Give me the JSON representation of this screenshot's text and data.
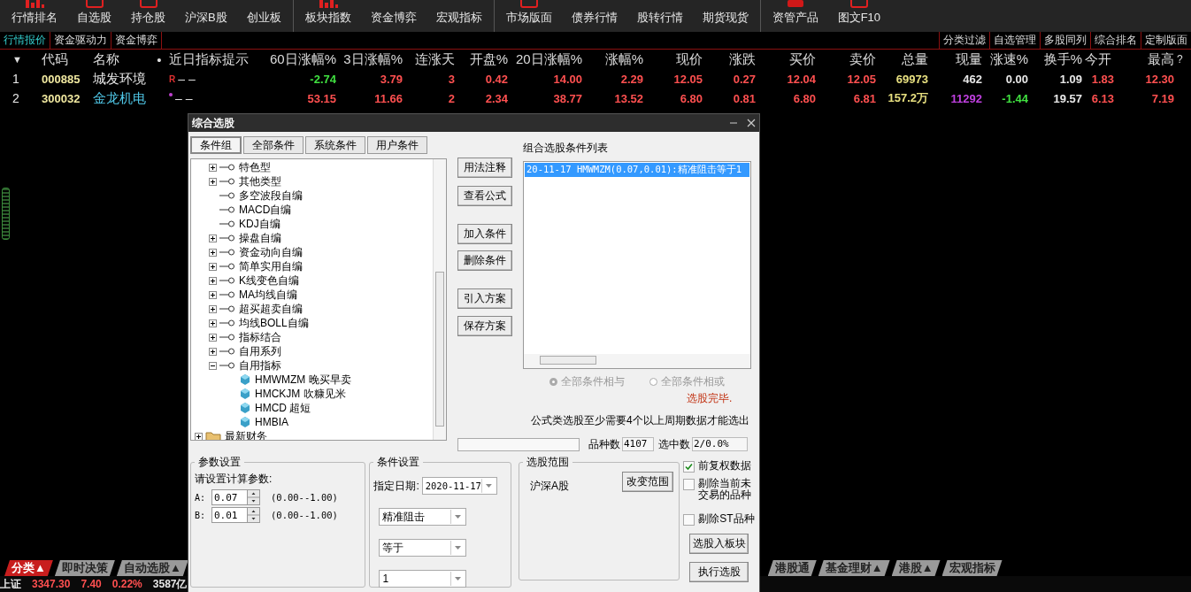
{
  "toolbar": [
    {
      "items": [
        {
          "label": "行情排名",
          "kind": "bars"
        },
        {
          "label": "自选股",
          "kind": "frame"
        },
        {
          "label": "持仓股",
          "kind": "frame"
        },
        {
          "label": "沪深B股",
          "kind": "plain"
        },
        {
          "label": "创业板",
          "kind": "plain"
        }
      ]
    },
    {
      "items": [
        {
          "label": "板块指数",
          "kind": "bars"
        },
        {
          "label": "资金博弈",
          "kind": "plain"
        },
        {
          "label": "宏观指标",
          "kind": "plain"
        }
      ]
    },
    {
      "items": [
        {
          "label": "市场版面",
          "kind": "frame"
        },
        {
          "label": "债券行情",
          "kind": "plain"
        },
        {
          "label": "股转行情",
          "kind": "plain"
        },
        {
          "label": "期货现货",
          "kind": "plain"
        }
      ]
    },
    {
      "items": [
        {
          "label": "资管产品",
          "kind": "box"
        },
        {
          "label": "图文F10",
          "kind": "frame"
        }
      ]
    }
  ],
  "view_tabs": [
    {
      "label": "行情报价",
      "selected": true
    },
    {
      "label": "资金驱动力",
      "selected": false
    },
    {
      "label": "资金博弈",
      "selected": false
    }
  ],
  "view_actions": [
    "分类过滤",
    "自选管理",
    "多股同列",
    "综合排名",
    "定制版面"
  ],
  "table": {
    "sort_mark": "▼",
    "columns": [
      "代码",
      "名称",
      "•",
      "近日指标提示",
      "60日涨幅%",
      "3日涨幅%",
      "连涨天",
      "开盘%",
      "20日涨幅%",
      "涨幅%",
      "现价",
      "涨跌",
      "买价",
      "卖价",
      "总量",
      "现量",
      "涨速%",
      "换手%",
      "今开",
      "最高",
      "?"
    ],
    "rows": [
      {
        "index": "1",
        "code": "000885",
        "name": "城发环境",
        "kind": "normal",
        "flag": "R",
        "hint": "– –",
        "values": [
          {
            "text": "-2.74",
            "kind": "down"
          },
          {
            "text": "3.79",
            "kind": "up"
          },
          {
            "text": "3",
            "kind": "up"
          },
          {
            "text": "0.42",
            "kind": "up"
          },
          {
            "text": "14.00",
            "kind": "up"
          },
          {
            "text": "2.29",
            "kind": "up"
          },
          {
            "text": "12.05",
            "kind": "up"
          },
          {
            "text": "0.27",
            "kind": "up"
          },
          {
            "text": "12.04",
            "kind": "up"
          },
          {
            "text": "12.05",
            "kind": "up"
          },
          {
            "text": "69973",
            "kind": "volume"
          },
          {
            "text": "462",
            "kind": "flat"
          },
          {
            "text": "0.00",
            "kind": "flat"
          },
          {
            "text": "1.09",
            "kind": "flat"
          },
          {
            "text": "1.83",
            "kind": "up"
          },
          {
            "text": "12.30",
            "kind": "up"
          }
        ]
      },
      {
        "index": "2",
        "code": "300032",
        "name": "金龙机电",
        "kind": "highlight",
        "hint": "– –",
        "values": [
          {
            "text": "53.15",
            "kind": "up"
          },
          {
            "text": "11.66",
            "kind": "up"
          },
          {
            "text": "2",
            "kind": "up"
          },
          {
            "text": "2.34",
            "kind": "up"
          },
          {
            "text": "38.77",
            "kind": "up"
          },
          {
            "text": "13.52",
            "kind": "up"
          },
          {
            "text": "6.80",
            "kind": "up"
          },
          {
            "text": "0.81",
            "kind": "up"
          },
          {
            "text": "6.80",
            "kind": "up"
          },
          {
            "text": "6.81",
            "kind": "up"
          },
          {
            "text": "157.2万",
            "kind": "volume"
          },
          {
            "text": "11292",
            "kind": "purple"
          },
          {
            "text": "-1.44",
            "kind": "down"
          },
          {
            "text": "19.57",
            "kind": "flat"
          },
          {
            "text": "6.13",
            "kind": "up"
          },
          {
            "text": "7.19",
            "kind": "up"
          }
        ]
      }
    ]
  },
  "bottom_tabs_left": [
    {
      "label": "分类▲",
      "selected": true
    },
    {
      "label": "即时决策",
      "selected": false
    },
    {
      "label": "自动选股▲",
      "selected": false
    }
  ],
  "bottom_tabs_right": [
    {
      "label": "港股通",
      "selected": false
    },
    {
      "label": "基金理财▲",
      "selected": false
    },
    {
      "label": "港股▲",
      "selected": false
    },
    {
      "label": "宏观指标",
      "selected": false
    }
  ],
  "status_bar": [
    {
      "text": "上证",
      "kind": "flat"
    },
    {
      "text": "3347.30",
      "kind": "up"
    },
    {
      "text": "7.40",
      "kind": "up"
    },
    {
      "text": "0.22%",
      "kind": "up"
    },
    {
      "text": "3587亿",
      "kind": "flat"
    }
  ],
  "dialog": {
    "title": "综合选股",
    "tabs": [
      {
        "label": "条件组",
        "selected": true
      },
      {
        "label": "全部条件",
        "selected": false
      },
      {
        "label": "系统条件",
        "selected": false
      },
      {
        "label": "用户条件",
        "selected": false
      }
    ],
    "tree": [
      {
        "label": "特色型",
        "kind": "group",
        "expanded": false
      },
      {
        "label": "其他类型",
        "kind": "group",
        "expanded": false
      },
      {
        "label": "多空波段自编",
        "kind": "leaf"
      },
      {
        "label": "MACD自编",
        "kind": "leaf"
      },
      {
        "label": "KDJ自编",
        "kind": "leaf"
      },
      {
        "label": "操盘自编",
        "kind": "group",
        "expanded": false
      },
      {
        "label": "资金动向自编",
        "kind": "group",
        "expanded": false
      },
      {
        "label": "简单实用自编",
        "kind": "group",
        "expanded": false
      },
      {
        "label": "K线变色自编",
        "kind": "group",
        "expanded": false
      },
      {
        "label": "MA均线自编",
        "kind": "group",
        "expanded": false
      },
      {
        "label": "超买超卖自编",
        "kind": "group",
        "expanded": false
      },
      {
        "label": "均线BOLL自编",
        "kind": "group",
        "expanded": false
      },
      {
        "label": "指标结合",
        "kind": "group",
        "expanded": false
      },
      {
        "label": "自用系列",
        "kind": "group",
        "expanded": false
      },
      {
        "label": "自用指标",
        "kind": "group",
        "expanded": true,
        "children": [
          {
            "label": "HMWMZM 晚买早卖",
            "kind": "formula"
          },
          {
            "label": "HMCKJM 吹糠见米",
            "kind": "formula"
          },
          {
            "label": "HMCD 超短",
            "kind": "formula"
          },
          {
            "label": "HMBIA",
            "kind": "formula"
          }
        ]
      },
      {
        "label": "最新财务",
        "kind": "folder",
        "expanded": false
      }
    ],
    "actions": [
      "用法注释",
      "查看公式",
      "加入条件",
      "删除条件",
      "引入方案",
      "保存方案"
    ],
    "conditions_label": "组合选股条件列表",
    "conditions": [
      {
        "text": "20-11-17 HMWMZM(0.07,0.01):精准阻击等于1",
        "selected": true
      }
    ],
    "logic": [
      {
        "label": "全部条件相与",
        "selected": true,
        "disabled": true
      },
      {
        "label": "全部条件相或",
        "selected": false,
        "disabled": true
      }
    ],
    "result": "选股完毕.",
    "note": "公式类选股至少需要4个以上周期数据才能选出",
    "count_label": "品种数",
    "count": "4107",
    "hits_label": "选中数",
    "hits": "2/0.0%",
    "params": {
      "title": "参数设置",
      "prompt": "请设置计算参数:",
      "items": [
        {
          "name": "A:",
          "value": "0.07",
          "range": "(0.00--1.00)"
        },
        {
          "name": "B:",
          "value": "0.01",
          "range": "(0.00--1.00)"
        }
      ]
    },
    "condition_setup": {
      "title": "条件设置",
      "date_label": "指定日期:",
      "date": "2020-11-17",
      "selects": [
        "精准阻击",
        "等于",
        "1"
      ]
    },
    "scope": {
      "title": "选股范围",
      "value": "沪深A股",
      "button": "改变范围"
    },
    "options": [
      {
        "label": "前复权数据",
        "checked": true
      },
      {
        "label": "剔除当前未交易的品种",
        "checked": false
      },
      {
        "label": "剔除ST品种",
        "checked": false
      }
    ],
    "buttons": [
      "选股入板块",
      "执行选股"
    ]
  }
}
